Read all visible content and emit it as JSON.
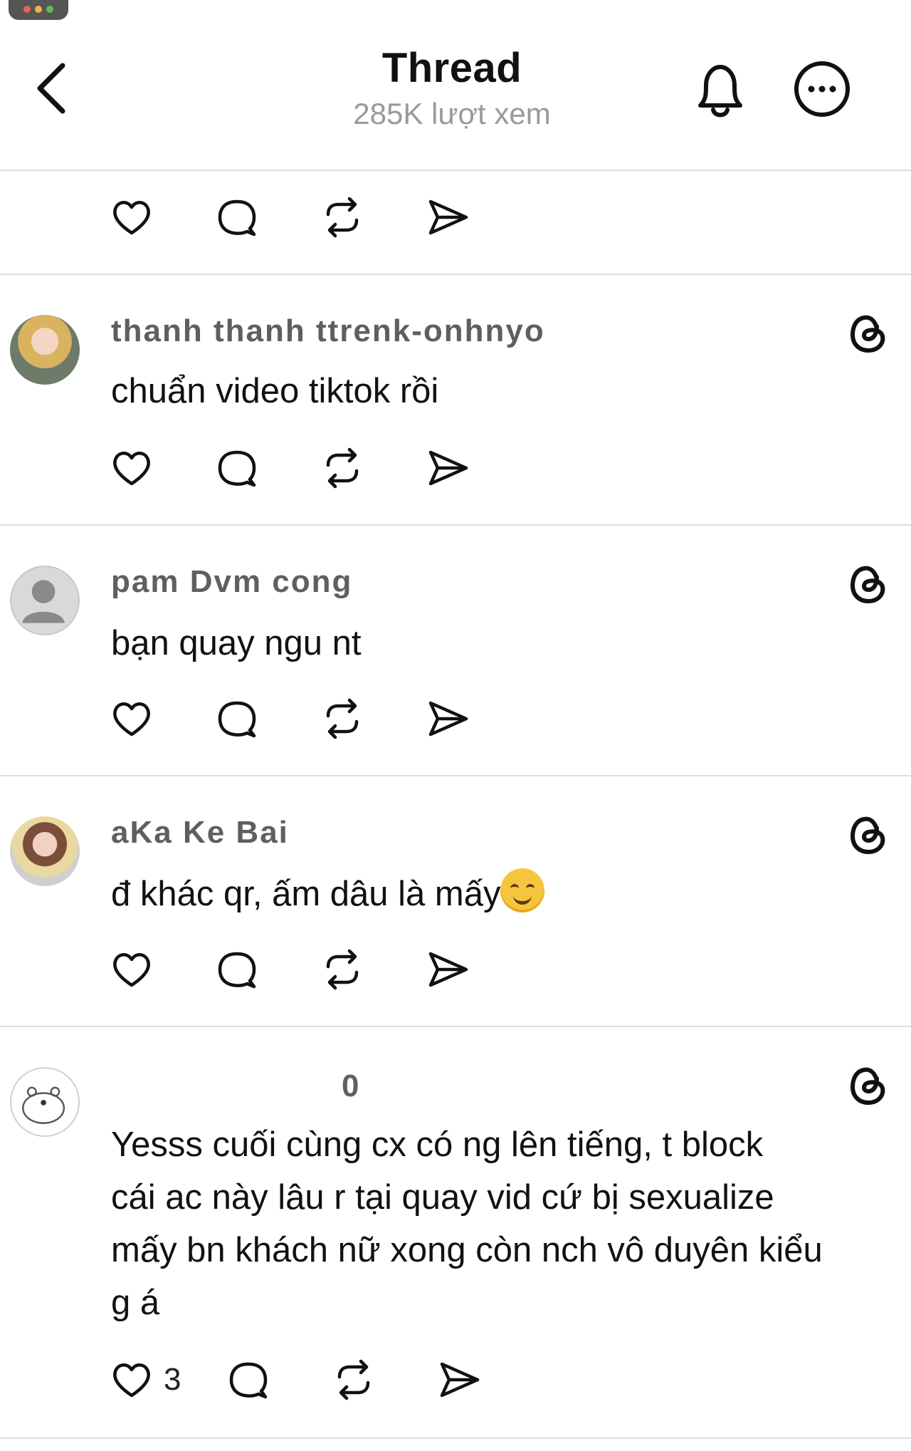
{
  "header": {
    "title": "Thread",
    "views": "285K lượt xem"
  },
  "comments": [
    {
      "username": "thanh thanh ttrenk-onhnyo",
      "text": "chuẩn video tiktok rồi",
      "likes": ""
    },
    {
      "username": "pam Dvm cong",
      "text": "bạn quay ngu nt",
      "likes": ""
    },
    {
      "username": "aKa Ke Bai",
      "text": "đ khác qr, ấm dâu là mấy",
      "likes": ""
    },
    {
      "username": "0",
      "text_lines": [
        "Yesss cuối cùng cx có ng lên tiếng, t block",
        "cái ac này lâu r tại quay vid cứ bị sexualize",
        "mấy bn khách nữ xong còn nch vô duyên kiểu",
        "g á"
      ],
      "likes": "3"
    }
  ],
  "icons": [
    "back-icon",
    "bell-icon",
    "more-icon",
    "heart-icon",
    "comment-icon",
    "repost-icon",
    "share-icon",
    "threads-icon"
  ]
}
